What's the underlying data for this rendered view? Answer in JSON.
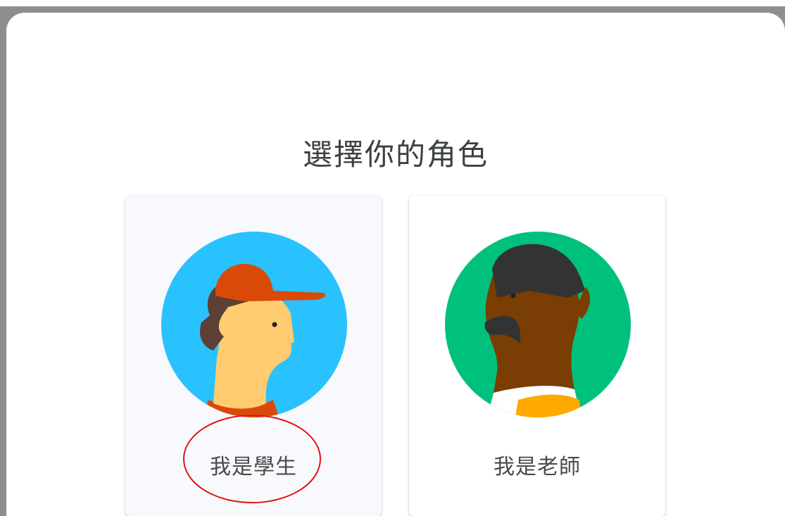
{
  "dialog": {
    "title": "選擇你的角色",
    "roles": [
      {
        "label": "我是學生",
        "icon": "student-avatar-icon",
        "selected": true
      },
      {
        "label": "我是老師",
        "icon": "teacher-avatar-icon",
        "selected": false
      }
    ]
  },
  "colors": {
    "overlay": "#8e8e8e",
    "student_bg": "#29c2ff",
    "teacher_bg": "#00c17c",
    "cap": "#d94a09",
    "highlight": "#e01414"
  }
}
